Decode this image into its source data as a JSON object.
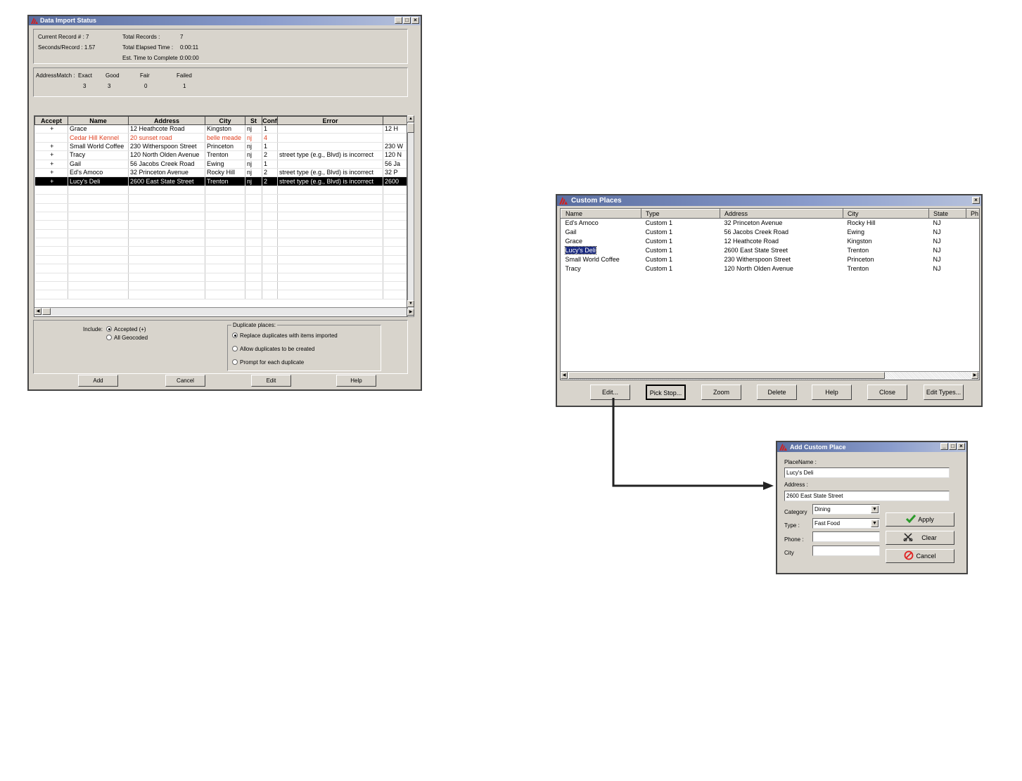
{
  "import_window": {
    "title": "Data Import Status",
    "stats": {
      "current_record": "Current Record # : 7",
      "seconds_record": "Seconds/Record : 1.57",
      "total_records_label": "Total Records :",
      "total_records_value": "7",
      "total_elapsed_label": "Total Elapsed Time :",
      "total_elapsed_value": "0:00:11",
      "est_time_label": "Est. Time to Complete :",
      "est_time_value": "0:00:00"
    },
    "match": {
      "label": "AddressMatch :",
      "headers": [
        "Exact",
        "Good",
        "Fair",
        "Failed"
      ],
      "values": [
        "3",
        "3",
        "0",
        "1"
      ]
    },
    "columns": [
      "Accept",
      "Name",
      "Address",
      "City",
      "St",
      "Conf",
      "Error",
      ""
    ],
    "rows": [
      {
        "accept": "+",
        "name": "Grace",
        "address": "12 Heathcote Road",
        "city": "Kingston",
        "st": "nj",
        "conf": "1",
        "error": "",
        "extra": "12 H"
      },
      {
        "accept": "",
        "name": "Cedar Hill Kennel",
        "address": "20 sunset road",
        "city": "belle meade",
        "st": "nj",
        "conf": "4",
        "error": "",
        "extra": ""
      },
      {
        "accept": "+",
        "name": "Small World Coffee",
        "address": "230 Witherspoon Street",
        "city": "Princeton",
        "st": "nj",
        "conf": "1",
        "error": "",
        "extra": "230 W"
      },
      {
        "accept": "+",
        "name": "Tracy",
        "address": "120 North Olden Avenue",
        "city": "Trenton",
        "st": "nj",
        "conf": "2",
        "error": "street type (e.g., Blvd) is incorrect",
        "extra": "120 N"
      },
      {
        "accept": "+",
        "name": "Gail",
        "address": "56 Jacobs Creek Road",
        "city": "Ewing",
        "st": "nj",
        "conf": "1",
        "error": "",
        "extra": "56 Ja"
      },
      {
        "accept": "+",
        "name": "Ed's Amoco",
        "address": "32 Princeton Avenue",
        "city": "Rocky Hill",
        "st": "nj",
        "conf": "2",
        "error": "street type (e.g., Blvd) is incorrect",
        "extra": "32 P"
      },
      {
        "accept": "+",
        "name": "Lucy's Deli",
        "address": "2600 East State Street",
        "city": "Trenton",
        "st": "nj",
        "conf": "2",
        "error": "street type (e.g., Blvd) is incorrect",
        "extra": "2600"
      }
    ],
    "include": {
      "label": "Include:",
      "accepted": "Accepted (+)",
      "all_geocoded": "All Geocoded"
    },
    "duplicates": {
      "legend": "Duplicate places:",
      "replace": "Replace duplicates with items imported",
      "allow": "Allow duplicates to be created",
      "prompt": "Prompt for each duplicate"
    },
    "buttons": {
      "add": "Add",
      "cancel": "Cancel",
      "edit": "Edit",
      "help": "Help"
    }
  },
  "custom_places": {
    "title": "Custom Places",
    "columns": [
      "Name",
      "Type",
      "Address",
      "City",
      "State",
      "Ph"
    ],
    "rows": [
      {
        "name": "Ed's Amoco",
        "type": "Custom 1",
        "address": "32 Princeton Avenue",
        "city": "Rocky Hill",
        "state": "NJ"
      },
      {
        "name": "Gail",
        "type": "Custom 1",
        "address": "56 Jacobs Creek Road",
        "city": "Ewing",
        "state": "NJ"
      },
      {
        "name": "Grace",
        "type": "Custom 1",
        "address": "12 Heathcote Road",
        "city": "Kingston",
        "state": "NJ"
      },
      {
        "name": "Lucy's Deli",
        "type": "Custom 1",
        "address": "2600 East State Street",
        "city": "Trenton",
        "state": "NJ"
      },
      {
        "name": "Small World Coffee",
        "type": "Custom 1",
        "address": "230 Witherspoon Street",
        "city": "Princeton",
        "state": "NJ"
      },
      {
        "name": "Tracy",
        "type": "Custom 1",
        "address": "120 North Olden Avenue",
        "city": "Trenton",
        "state": "NJ"
      }
    ],
    "buttons": {
      "edit": "Edit...",
      "pick_stop": "Pick Stop...",
      "zoom": "Zoom",
      "delete": "Delete",
      "help": "Help",
      "close": "Close",
      "edit_types": "Edit Types..."
    }
  },
  "add_place": {
    "title": "Add Custom Place",
    "placename_label": "PlaceName :",
    "placename_value": "Lucy's Deli",
    "address_label": "Address :",
    "address_value": "2600 East State Street",
    "category_label": "Category",
    "category_value": "Dining",
    "type_label": "Type :",
    "type_value": "Fast Food",
    "phone_label": "Phone :",
    "phone_value": "",
    "city_label": "City",
    "city_value": "",
    "buttons": {
      "apply": "Apply",
      "clear": "Clear",
      "cancel": "Cancel"
    }
  },
  "colors": {
    "title_bar": "#5a6ea0",
    "failed_row": "#e04020",
    "selected_row": "#000000",
    "apply_check": "#2a9a2a",
    "cancel_icon": "#e02020"
  }
}
